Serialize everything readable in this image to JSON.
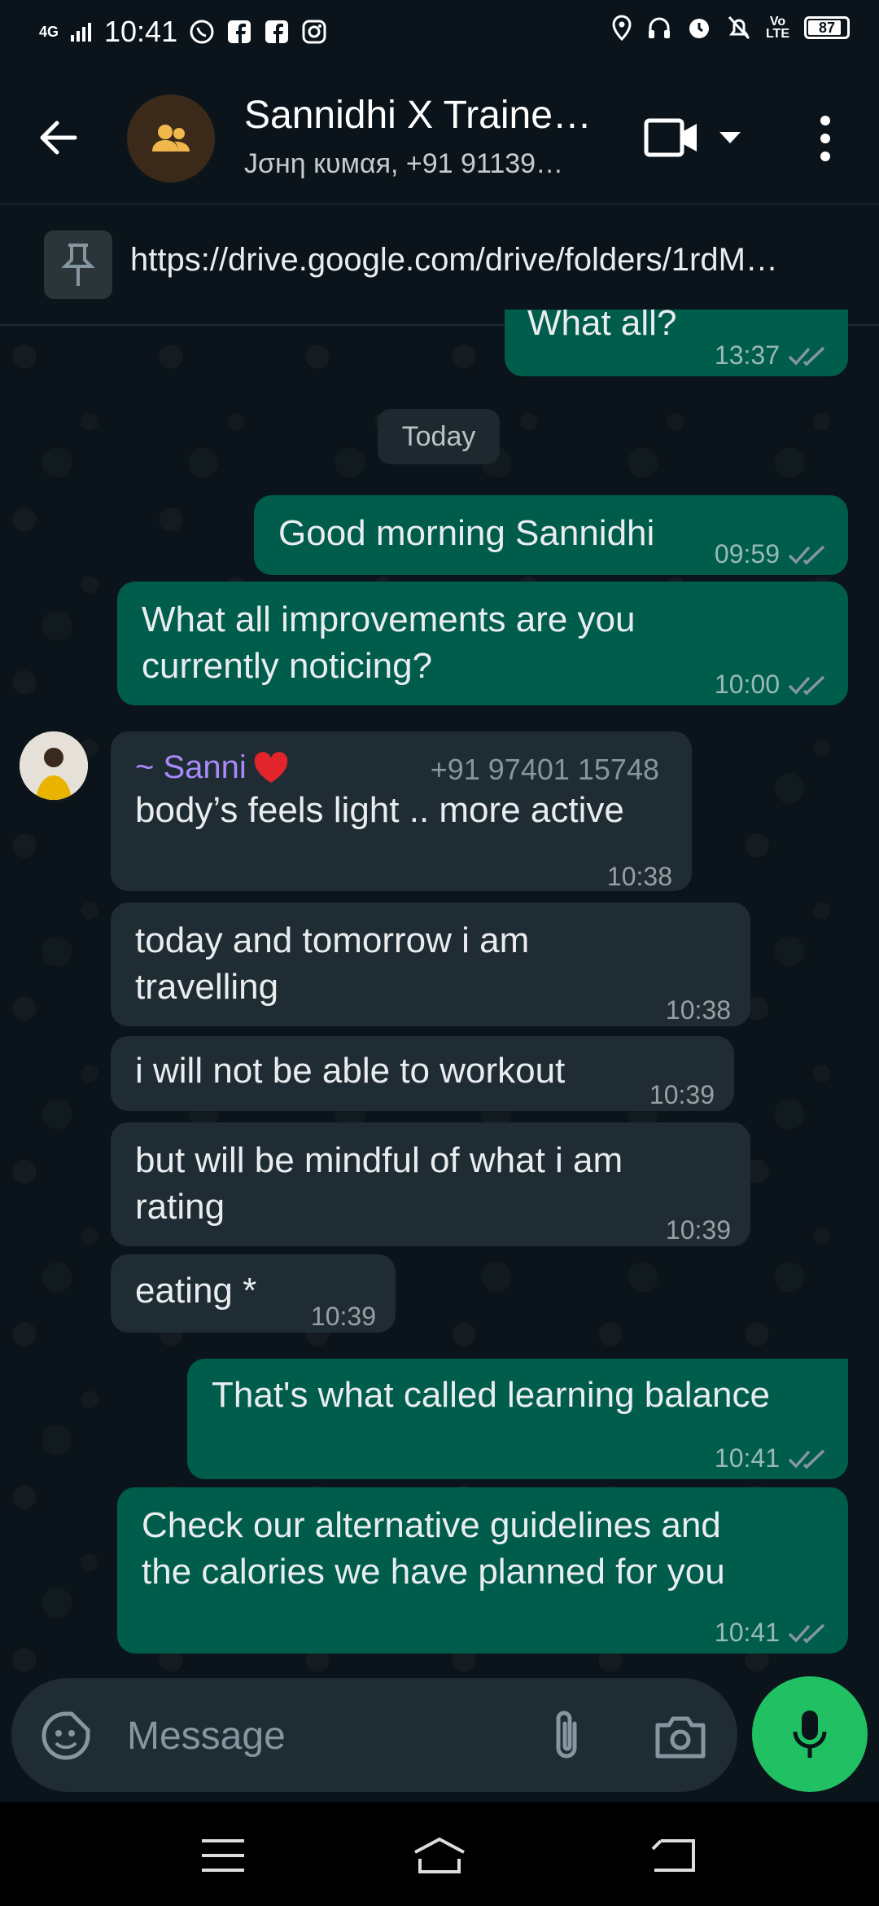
{
  "status_bar": {
    "time": "10:41",
    "network": "4G",
    "battery": "87",
    "volte": "Vo\nLTE"
  },
  "header": {
    "title": "Sannidhi X Traine…",
    "subtitle": "Jσнη кυмαя, +91 91139…"
  },
  "pinned": {
    "text": "https://drive.google.com/drive/folders/1rdM…"
  },
  "date_chip": "Today",
  "messages": [
    {
      "text": "What all?",
      "time": "13:37",
      "dir": "out"
    },
    {
      "text": "Good morning Sannidhi",
      "time": "09:59",
      "dir": "out"
    },
    {
      "text": "What all improvements are you\ncurrently noticing?",
      "time": "10:00",
      "dir": "out"
    },
    {
      "sender": "~ Sanni",
      "sender_phone": "+91 97401 15748",
      "text": "body’s feels light .. more active",
      "time": "10:38",
      "dir": "in"
    },
    {
      "text": "today and tomorrow i am\ntravelling",
      "time": "10:38",
      "dir": "in"
    },
    {
      "text": "i will not be able to workout",
      "time": "10:39",
      "dir": "in"
    },
    {
      "text": "but will be mindful of what i am\nrating",
      "time": "10:39",
      "dir": "in"
    },
    {
      "text": "eating *",
      "time": "10:39",
      "dir": "in"
    },
    {
      "text": "That's what called learning balance",
      "time": "10:41",
      "dir": "out"
    },
    {
      "text": "Check our alternative guidelines and\nthe calories we have planned for you",
      "time": "10:41",
      "dir": "out"
    }
  ],
  "input": {
    "placeholder": "Message"
  },
  "colors": {
    "background": "#0b141a",
    "outgoing_bubble": "#005c4b",
    "incoming_bubble": "#202c33",
    "mic_button": "#21c063",
    "sender_name": "#a78bfa"
  }
}
